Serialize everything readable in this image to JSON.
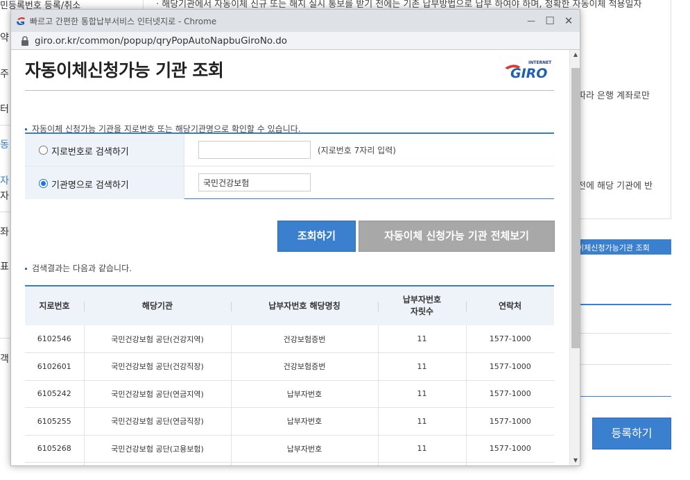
{
  "background": {
    "top_line": "민등록번호 등록/취소",
    "top_notice": "· 해당기관에서 자동이체 신규 또는 해지 실시 통보를 받기 전에는 기존 납부방법으로 납부 하여야 하며, 정확한 자동이체 적용일자",
    "side_items": [
      "약",
      "주",
      "터",
      "동",
      "자",
      "자",
      "좌",
      "표",
      "객"
    ],
    "text_bank": "따라 은행 계좌로만",
    "text_before": "전에 해당 기관에 반",
    "tab_label": "이체신청가능기관 조회",
    "register_button": "등록하기"
  },
  "window": {
    "title": "빠르고 간편한 통합납부서비스 인터넷지로 - Chrome",
    "url": "giro.or.kr/common/popup/qryPopAutoNapbuGiroNo.do",
    "minimize": "—",
    "maximize": "☐",
    "close": "✕"
  },
  "page": {
    "title": "자동이체신청가능 기관 조회",
    "logo_small": "INTERNET",
    "logo_big": "GIRO",
    "info": "자동이체 신청가능 기관을 지로번호 또는 해당기관명으로 확인할 수 있습니다.",
    "result_info": "검색결과는 다음과 같습니다."
  },
  "search": {
    "option_giro_label": "지로번호로 검색하기",
    "option_giro_selected": false,
    "giro_input_value": "",
    "giro_hint": "(지로번호 7자리 입력)",
    "option_org_label": "기관명으로 검색하기",
    "option_org_selected": true,
    "org_input_value": "국민건강보험"
  },
  "buttons": {
    "search": "조회하기",
    "view_all": "자동이체 신청가능 기관 전체보기"
  },
  "table": {
    "headers": [
      "지로번호",
      "해당기관",
      "납부자번호 해당명칭",
      "납부자번호\n자릿수",
      "연락처"
    ],
    "rows": [
      [
        "6102546",
        "국민건강보험 공단(건강지역)",
        "건강보험증번",
        "11",
        "1577-1000"
      ],
      [
        "6102601",
        "국민건강보험 공단(건강직장)",
        "건강보험증번",
        "11",
        "1577-1000"
      ],
      [
        "6105242",
        "국민건강보험 공단(연금지역)",
        "납부자번호",
        "11",
        "1577-1000"
      ],
      [
        "6105255",
        "국민건강보험 공단(연금직장)",
        "납부자번호",
        "11",
        "1577-1000"
      ],
      [
        "6105268",
        "국민건강보험 공단(고용보험)",
        "납부자번호",
        "11",
        "1577-1000"
      ],
      [
        "",
        "",
        "",
        "",
        ""
      ]
    ]
  },
  "colors": {
    "accent_blue": "#3a80cf",
    "button_gray": "#a8a8a8",
    "header_bg": "#eef3fa"
  }
}
